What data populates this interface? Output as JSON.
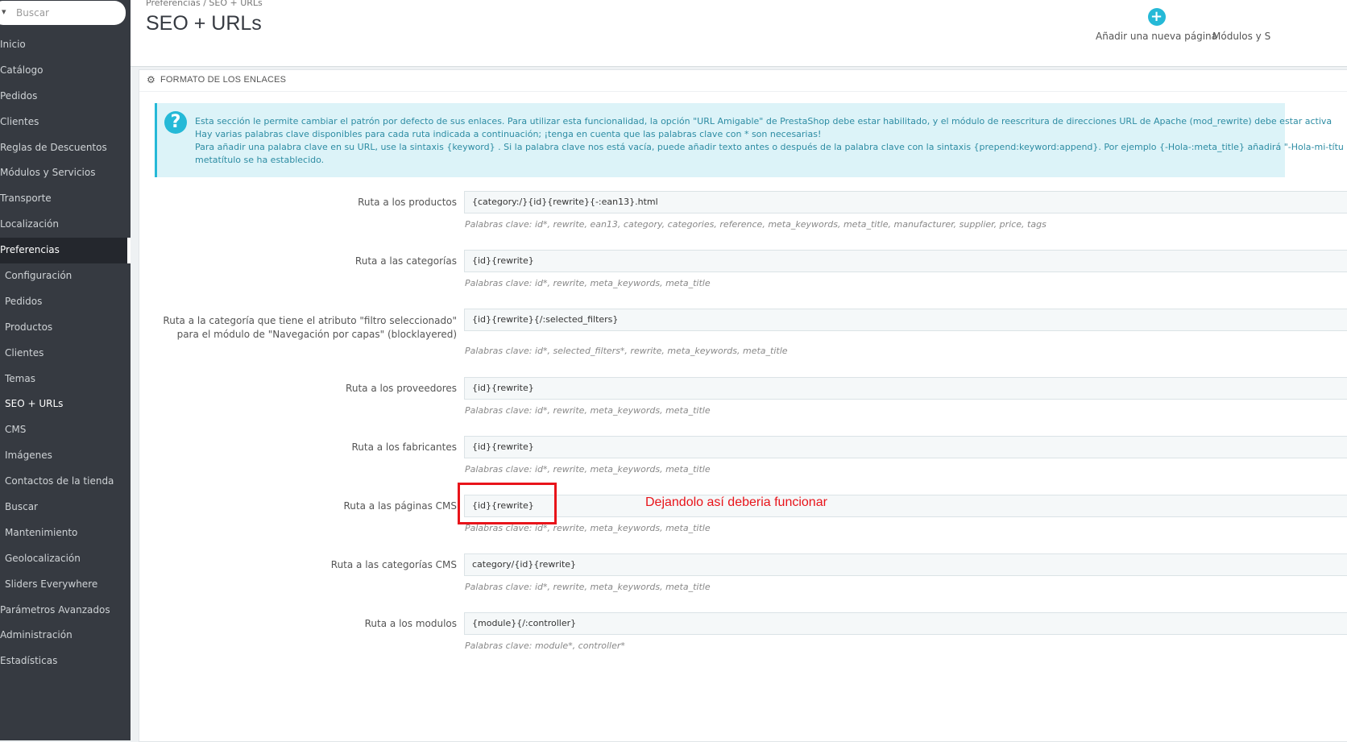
{
  "sidebar": {
    "search_placeholder": "Buscar",
    "items": [
      {
        "label": "Inicio"
      },
      {
        "label": "Catálogo"
      },
      {
        "label": "Pedidos"
      },
      {
        "label": "Clientes"
      },
      {
        "label": "Reglas de Descuentos"
      },
      {
        "label": "Módulos y Servicios"
      },
      {
        "label": "Transporte"
      },
      {
        "label": "Localización"
      },
      {
        "label": "Preferencias"
      },
      {
        "label": "Configuración"
      },
      {
        "label": "Pedidos"
      },
      {
        "label": "Productos"
      },
      {
        "label": "Clientes"
      },
      {
        "label": "Temas"
      },
      {
        "label": "SEO + URLs"
      },
      {
        "label": "CMS"
      },
      {
        "label": "Imágenes"
      },
      {
        "label": "Contactos de la tienda"
      },
      {
        "label": "Buscar"
      },
      {
        "label": "Mantenimiento"
      },
      {
        "label": "Geolocalización"
      },
      {
        "label": "Sliders Everywhere"
      },
      {
        "label": "Parámetros Avanzados"
      },
      {
        "label": "Administración"
      },
      {
        "label": "Estadísticas"
      }
    ]
  },
  "header": {
    "breadcrumb": "Preferencias  /  SEO + URLs",
    "title": "SEO + URLs",
    "add_page_label": "Añadir una nueva página",
    "modules_label": "Módulos y S"
  },
  "panel": {
    "heading": "FORMATO DE LOS ENLACES",
    "info_lines": [
      "Esta sección le permite cambiar el patrón por defecto de sus enlaces. Para utilizar esta funcionalidad, la opción \"URL Amigable\" de PrestaShop debe estar habilitado, y el módulo de reescritura de direcciones URL de Apache (mod_rewrite) debe estar activa",
      "Hay varias palabras clave disponibles para cada ruta indicada a continuación; ¡tenga en cuenta que las palabras clave con * son necesarias!",
      "Para añadir una palabra clave en su URL, use la sintaxis {keyword} . Si la palabra clave nos está vacía, puede añadir texto antes o después de la palabra clave con la sintaxis {prepend:keyword:append}. Por ejemplo {-Hola-:meta_title} añadirá \"-Hola-mi-títu",
      "metatítulo se ha establecido."
    ],
    "rows": [
      {
        "label": "Ruta a los productos",
        "value": "{category:/}{id}{rewrite}{-:ean13}.html",
        "help": "Palabras clave: id*, rewrite, ean13, category, categories, reference, meta_keywords, meta_title, manufacturer, supplier, price, tags"
      },
      {
        "label": "Ruta a las categorías",
        "value": "{id}{rewrite}",
        "help": "Palabras clave: id*, rewrite, meta_keywords, meta_title"
      },
      {
        "label": "Ruta a la categoría que tiene el atributo \"filtro seleccionado\" para el módulo de \"Navegación por capas\" (blocklayered)",
        "value": "{id}{rewrite}{/:selected_filters}",
        "help": "Palabras clave: id*, selected_filters*, rewrite, meta_keywords, meta_title"
      },
      {
        "label": "Ruta a los proveedores",
        "value": "{id}{rewrite}",
        "help": "Palabras clave: id*, rewrite, meta_keywords, meta_title"
      },
      {
        "label": "Ruta a los fabricantes",
        "value": "{id}{rewrite}",
        "help": "Palabras clave: id*, rewrite, meta_keywords, meta_title"
      },
      {
        "label": "Ruta a las páginas CMS",
        "value": "{id}{rewrite}",
        "help": "Palabras clave: id*, rewrite, meta_keywords, meta_title"
      },
      {
        "label": "Ruta a las categorías CMS",
        "value": "category/{id}{rewrite}",
        "help": "Palabras clave: id*, rewrite, meta_keywords, meta_title"
      },
      {
        "label": "Ruta a los modulos",
        "value": "{module}{/:controller}",
        "help": "Palabras clave: module*, controller*"
      }
    ]
  },
  "annotation": {
    "text": "Dejandolo así deberia funcionar",
    "color": "#e8141a"
  },
  "colors": {
    "sidebar_bg": "#363a41",
    "accent": "#25b9d7"
  }
}
